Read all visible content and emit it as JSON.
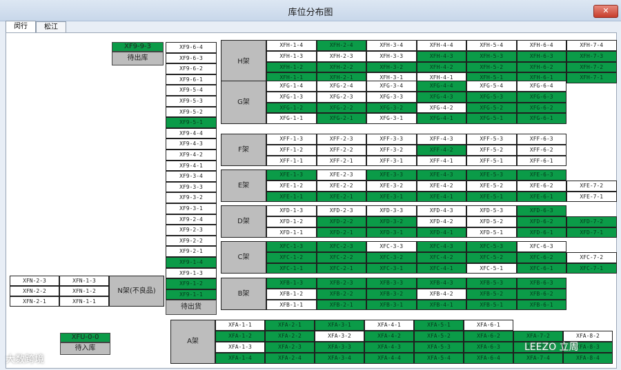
{
  "window": {
    "title": "库位分布图",
    "close_icon": "close-icon"
  },
  "tabs": [
    "闵行",
    "松江"
  ],
  "left_box": {
    "rows": [
      [
        "XFN-2-3",
        "XFN-1-3"
      ],
      [
        "XFN-2-2",
        "XFN-1-2"
      ],
      [
        "XFN-2-1",
        "XFN-1-1"
      ]
    ],
    "label": "N架(不良品)"
  },
  "pending_in": {
    "code": "XFU-0-0",
    "label": "待入库"
  },
  "pending_out_top": {
    "code": "XF9-9-3",
    "label": "待出库"
  },
  "col9": [
    "XF9-6-4",
    "XF9-6-3",
    "XF9-6-2",
    "XF9-6-1",
    "XF9-5-4",
    "XF9-5-3",
    "XF9-5-2",
    "XF9-5-1",
    "XF9-4-4",
    "XF9-4-3",
    "XF9-4-2",
    "XF9-4-1",
    "XF9-3-4",
    "XF9-3-3",
    "XF9-3-2",
    "XF9-3-1",
    "XF9-2-4",
    "XF9-2-3",
    "XF9-2-2",
    "XF9-2-1",
    "XF9-1-4",
    "XF9-1-3",
    "XF9-1-2",
    "XF9-1-1"
  ],
  "col9_green": [
    7,
    20,
    22,
    23
  ],
  "col9_bottom": "待出货",
  "racks": [
    {
      "label": "H架",
      "rows": [
        [
          [
            "XFH-1-4",
            0
          ],
          [
            "XFH-2-4",
            1
          ],
          [
            "XFH-3-4",
            0
          ],
          [
            "XFH-4-4",
            0
          ],
          [
            "XFH-5-4",
            0
          ],
          [
            "XFH-6-4",
            0
          ],
          [
            "XFH-7-4",
            0
          ]
        ],
        [
          [
            "XFH-1-3",
            0
          ],
          [
            "XFH-2-3",
            0
          ],
          [
            "XFH-3-3",
            0
          ],
          [
            "XFH-4-3",
            1
          ],
          [
            "XFH-5-3",
            1
          ],
          [
            "XFH-6-3",
            1
          ],
          [
            "XFH-7-3",
            1
          ]
        ],
        [
          [
            "XFH-1-2",
            1
          ],
          [
            "XFH-2-2",
            1
          ],
          [
            "XFH-3-2",
            1
          ],
          [
            "XFH-4-2",
            1
          ],
          [
            "XFH-5-2",
            1
          ],
          [
            "XFH-6-2",
            1
          ],
          [
            "XFH-7-2",
            1
          ]
        ],
        [
          [
            "XFH-1-1",
            1
          ],
          [
            "XFH-2-1",
            1
          ],
          [
            "XFH-3-1",
            0
          ],
          [
            "XFH-4-1",
            0
          ],
          [
            "XFH-5-1",
            1
          ],
          [
            "XFH-6-1",
            1
          ],
          [
            "XFH-7-1",
            1
          ]
        ]
      ]
    },
    {
      "label": "G架",
      "rows": [
        [
          [
            "XFG-1-4",
            0
          ],
          [
            "XFG-2-4",
            0
          ],
          [
            "XFG-3-4",
            0
          ],
          [
            "XFG-4-4",
            1
          ],
          [
            "XFG-5-4",
            0
          ],
          [
            "XFG-6-4",
            0
          ]
        ],
        [
          [
            "XFG-1-3",
            0
          ],
          [
            "XFG-2-3",
            0
          ],
          [
            "XFG-3-3",
            0
          ],
          [
            "XFG-4-3",
            1
          ],
          [
            "XFG-5-3",
            1
          ],
          [
            "XFG-6-3",
            1
          ]
        ],
        [
          [
            "XFG-1-2",
            1
          ],
          [
            "XFG-2-2",
            1
          ],
          [
            "XFG-3-2",
            1
          ],
          [
            "XFG-4-2",
            0
          ],
          [
            "XFG-5-2",
            1
          ],
          [
            "XFG-6-2",
            1
          ]
        ],
        [
          [
            "XFG-1-1",
            0
          ],
          [
            "XFG-2-1",
            1
          ],
          [
            "XFG-3-1",
            0
          ],
          [
            "XFG-4-1",
            1
          ],
          [
            "XFG-5-1",
            1
          ],
          [
            "XFG-6-1",
            1
          ]
        ]
      ]
    },
    {
      "label": "F架",
      "rows": [
        [
          [
            "XFF-1-3",
            0
          ],
          [
            "XFF-2-3",
            0
          ],
          [
            "XFF-3-3",
            0
          ],
          [
            "XFF-4-3",
            0
          ],
          [
            "XFF-5-3",
            0
          ],
          [
            "XFF-6-3",
            0
          ]
        ],
        [
          [
            "XFF-1-2",
            0
          ],
          [
            "XFF-2-2",
            0
          ],
          [
            "XFF-3-2",
            0
          ],
          [
            "XFF-4-2",
            1
          ],
          [
            "XFF-5-2",
            0
          ],
          [
            "XFF-6-2",
            0
          ]
        ],
        [
          [
            "XFF-1-1",
            0
          ],
          [
            "XFF-2-1",
            0
          ],
          [
            "XFF-3-1",
            0
          ],
          [
            "XFF-4-1",
            0
          ],
          [
            "XFF-5-1",
            0
          ],
          [
            "XFF-6-1",
            0
          ]
        ]
      ]
    },
    {
      "label": "E架",
      "rows": [
        [
          [
            "XFE-1-3",
            1
          ],
          [
            "XFE-2-3",
            0
          ],
          [
            "XFE-3-3",
            1
          ],
          [
            "XFE-4-3",
            1
          ],
          [
            "XFE-5-3",
            1
          ],
          [
            "XFE-6-3",
            1
          ]
        ],
        [
          [
            "XFE-1-2",
            0
          ],
          [
            "XFE-2-2",
            0
          ],
          [
            "XFE-3-2",
            0
          ],
          [
            "XFE-4-2",
            0
          ],
          [
            "XFE-5-2",
            0
          ],
          [
            "XFE-6-2",
            0
          ],
          [
            "XFE-7-2",
            0
          ]
        ],
        [
          [
            "XFE-1-1",
            1
          ],
          [
            "XFE-2-1",
            1
          ],
          [
            "XFE-3-1",
            1
          ],
          [
            "XFE-4-1",
            1
          ],
          [
            "XFE-5-1",
            1
          ],
          [
            "XFE-6-1",
            1
          ],
          [
            "XFE-7-1",
            0
          ]
        ]
      ]
    },
    {
      "label": "D架",
      "rows": [
        [
          [
            "XFD-1-3",
            0
          ],
          [
            "XFD-2-3",
            0
          ],
          [
            "XFD-3-3",
            0
          ],
          [
            "XFD-4-3",
            0
          ],
          [
            "XFD-5-3",
            0
          ],
          [
            "XFD-6-3",
            1
          ]
        ],
        [
          [
            "XFD-1-2",
            0
          ],
          [
            "XFD-2-2",
            1
          ],
          [
            "XFD-3-2",
            1
          ],
          [
            "XFD-4-2",
            0
          ],
          [
            "XFD-5-2",
            0
          ],
          [
            "XFD-6-2",
            1
          ],
          [
            "XFD-7-2",
            1
          ]
        ],
        [
          [
            "XFD-1-1",
            0
          ],
          [
            "XFD-2-1",
            1
          ],
          [
            "XFD-3-1",
            1
          ],
          [
            "XFD-4-1",
            1
          ],
          [
            "XFD-5-1",
            0
          ],
          [
            "XFD-6-1",
            1
          ],
          [
            "XFD-7-1",
            1
          ]
        ]
      ]
    },
    {
      "label": "C架",
      "rows": [
        [
          [
            "XFC-1-3",
            1
          ],
          [
            "XFC-2-3",
            1
          ],
          [
            "XFC-3-3",
            0
          ],
          [
            "XFC-4-3",
            1
          ],
          [
            "XFC-5-3",
            1
          ],
          [
            "XFC-6-3",
            0
          ]
        ],
        [
          [
            "XFC-1-2",
            1
          ],
          [
            "XFC-2-2",
            1
          ],
          [
            "XFC-3-2",
            1
          ],
          [
            "XFC-4-2",
            1
          ],
          [
            "XFC-5-2",
            1
          ],
          [
            "XFC-6-2",
            1
          ],
          [
            "XFC-7-2",
            0
          ]
        ],
        [
          [
            "XFC-1-1",
            1
          ],
          [
            "XFC-2-1",
            1
          ],
          [
            "XFC-3-1",
            1
          ],
          [
            "XFC-4-1",
            1
          ],
          [
            "XFC-5-1",
            0
          ],
          [
            "XFC-6-1",
            1
          ],
          [
            "XFC-7-1",
            1
          ]
        ]
      ]
    },
    {
      "label": "B架",
      "rows": [
        [
          [
            "XFB-1-3",
            1
          ],
          [
            "XFB-2-3",
            1
          ],
          [
            "XFB-3-3",
            1
          ],
          [
            "XFB-4-3",
            1
          ],
          [
            "XFB-5-3",
            1
          ],
          [
            "XFB-6-3",
            1
          ]
        ],
        [
          [
            "XFB-1-2",
            0
          ],
          [
            "XFB-2-2",
            1
          ],
          [
            "XFB-3-2",
            1
          ],
          [
            "XFB-4-2",
            0
          ],
          [
            "XFB-5-2",
            1
          ],
          [
            "XFB-6-2",
            1
          ]
        ],
        [
          [
            "XFB-1-1",
            0
          ],
          [
            "XFB-2-1",
            1
          ],
          [
            "XFB-3-1",
            1
          ],
          [
            "XFB-4-1",
            1
          ],
          [
            "XFB-5-1",
            1
          ],
          [
            "XFB-6-1",
            1
          ]
        ]
      ]
    },
    {
      "label": "A架",
      "rows": [
        [
          [
            "XFA-1-1",
            0
          ],
          [
            "XFA-2-1",
            1
          ],
          [
            "XFA-3-1",
            1
          ],
          [
            "XFA-4-1",
            0
          ],
          [
            "XFA-5-1",
            1
          ],
          [
            "XFA-6-1",
            0
          ]
        ],
        [
          [
            "XFA-1-2",
            1
          ],
          [
            "XFA-2-2",
            1
          ],
          [
            "XFA-3-2",
            0
          ],
          [
            "XFA-4-2",
            1
          ],
          [
            "XFA-5-2",
            1
          ],
          [
            "XFA-6-2",
            1
          ],
          [
            "XFA-7-2",
            1
          ],
          [
            "XFA-8-2",
            0
          ]
        ],
        [
          [
            "XFA-1-3",
            0
          ],
          [
            "XFA-2-3",
            1
          ],
          [
            "XFA-3-3",
            1
          ],
          [
            "XFA-4-3",
            1
          ],
          [
            "XFA-5-3",
            1
          ],
          [
            "XFA-6-3",
            1
          ],
          [
            "XFA-7-3",
            1
          ],
          [
            "XFA-8-3",
            1
          ]
        ],
        [
          [
            "XFA-1-4",
            1
          ],
          [
            "XFA-2-4",
            1
          ],
          [
            "XFA-3-4",
            1
          ],
          [
            "XFA-4-4",
            1
          ],
          [
            "XFA-5-4",
            1
          ],
          [
            "XFA-6-4",
            1
          ],
          [
            "XFA-7-4",
            1
          ],
          [
            "XFA-8-4",
            1
          ]
        ]
      ]
    }
  ],
  "watermark": {
    "left": "大数跨境",
    "right": "LEEZO 立周"
  },
  "colors": {
    "green": "#0b9b48",
    "gray": "#bdbdbd"
  }
}
